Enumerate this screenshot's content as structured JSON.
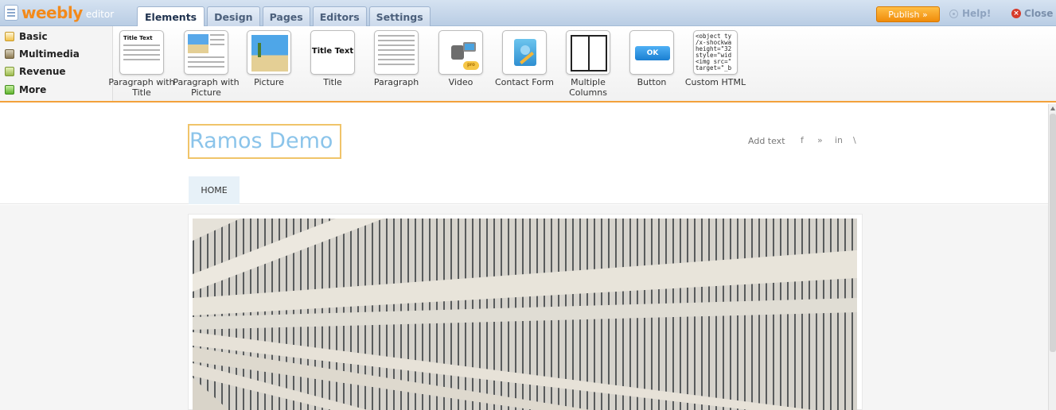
{
  "app": {
    "logo_text": "weebly",
    "logo_sub": "editor"
  },
  "tabs": [
    "Elements",
    "Design",
    "Pages",
    "Editors",
    "Settings"
  ],
  "topbar": {
    "publish_label": "Publish »",
    "help_label": "Help!",
    "close_label": "Close"
  },
  "categories": [
    "Basic",
    "Multimedia",
    "Revenue",
    "More"
  ],
  "elements": {
    "paragraph_with_title": {
      "label": "Paragraph with Title",
      "preview_title": "Title Text"
    },
    "paragraph_with_picture": {
      "label": "Paragraph with Picture"
    },
    "picture": {
      "label": "Picture"
    },
    "title": {
      "label": "Title",
      "preview_text": "Title Text"
    },
    "paragraph": {
      "label": "Paragraph"
    },
    "video": {
      "label": "Video",
      "badge": "pro"
    },
    "contact_form": {
      "label": "Contact Form"
    },
    "multiple_columns": {
      "label": "Multiple Columns"
    },
    "button": {
      "label": "Button",
      "preview_text": "OK"
    },
    "custom_html": {
      "label": "Custom HTML",
      "preview_code": "<object ty\n/x-shockwa\nheight=\"32\nstyle=\"wid\n<img src=\"\ntarget=\"_b"
    }
  },
  "site": {
    "title": "Ramos Demo",
    "add_text": "Add text",
    "social": [
      "f",
      "»",
      "in",
      "\\"
    ],
    "nav": [
      "HOME"
    ]
  },
  "colors": {
    "accent": "#f3a13b",
    "site_title": "#8bc4ea",
    "publish": "#f08c0a"
  }
}
